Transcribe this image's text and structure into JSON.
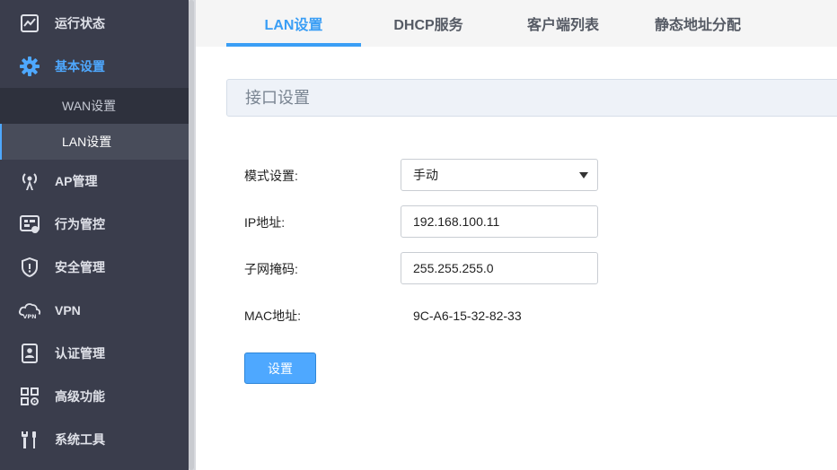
{
  "sidebar": {
    "items": [
      {
        "label": "运行状态",
        "icon": "monitor-chart-icon"
      },
      {
        "label": "基本设置",
        "icon": "gear-icon",
        "active": true
      },
      {
        "label": "AP管理",
        "icon": "antenna-icon"
      },
      {
        "label": "行为管控",
        "icon": "control-panel-icon"
      },
      {
        "label": "安全管理",
        "icon": "shield-icon"
      },
      {
        "label": "VPN",
        "icon": "vpn-cloud-icon"
      },
      {
        "label": "认证管理",
        "icon": "id-badge-icon"
      },
      {
        "label": "高级功能",
        "icon": "grid-gear-icon"
      },
      {
        "label": "系统工具",
        "icon": "tools-icon"
      }
    ],
    "subitems": [
      {
        "label": "WAN设置"
      },
      {
        "label": "LAN设置",
        "active": true
      }
    ]
  },
  "tabs": [
    {
      "label": "LAN设置",
      "active": true
    },
    {
      "label": "DHCP服务"
    },
    {
      "label": "客户端列表"
    },
    {
      "label": "静态地址分配"
    }
  ],
  "section": {
    "title": "接口设置"
  },
  "form": {
    "mode": {
      "label": "模式设置:",
      "value": "手动"
    },
    "ip": {
      "label": "IP地址:",
      "value": "192.168.100.11"
    },
    "mask": {
      "label": "子网掩码:",
      "value": "255.255.255.0"
    },
    "mac": {
      "label": "MAC地址:",
      "value": "9C-A6-15-32-82-33"
    },
    "submit_label": "设置"
  },
  "colors": {
    "accent": "#3a9ef5",
    "sidebar_bg": "#3a3d4c",
    "button": "#4ea8ff"
  }
}
